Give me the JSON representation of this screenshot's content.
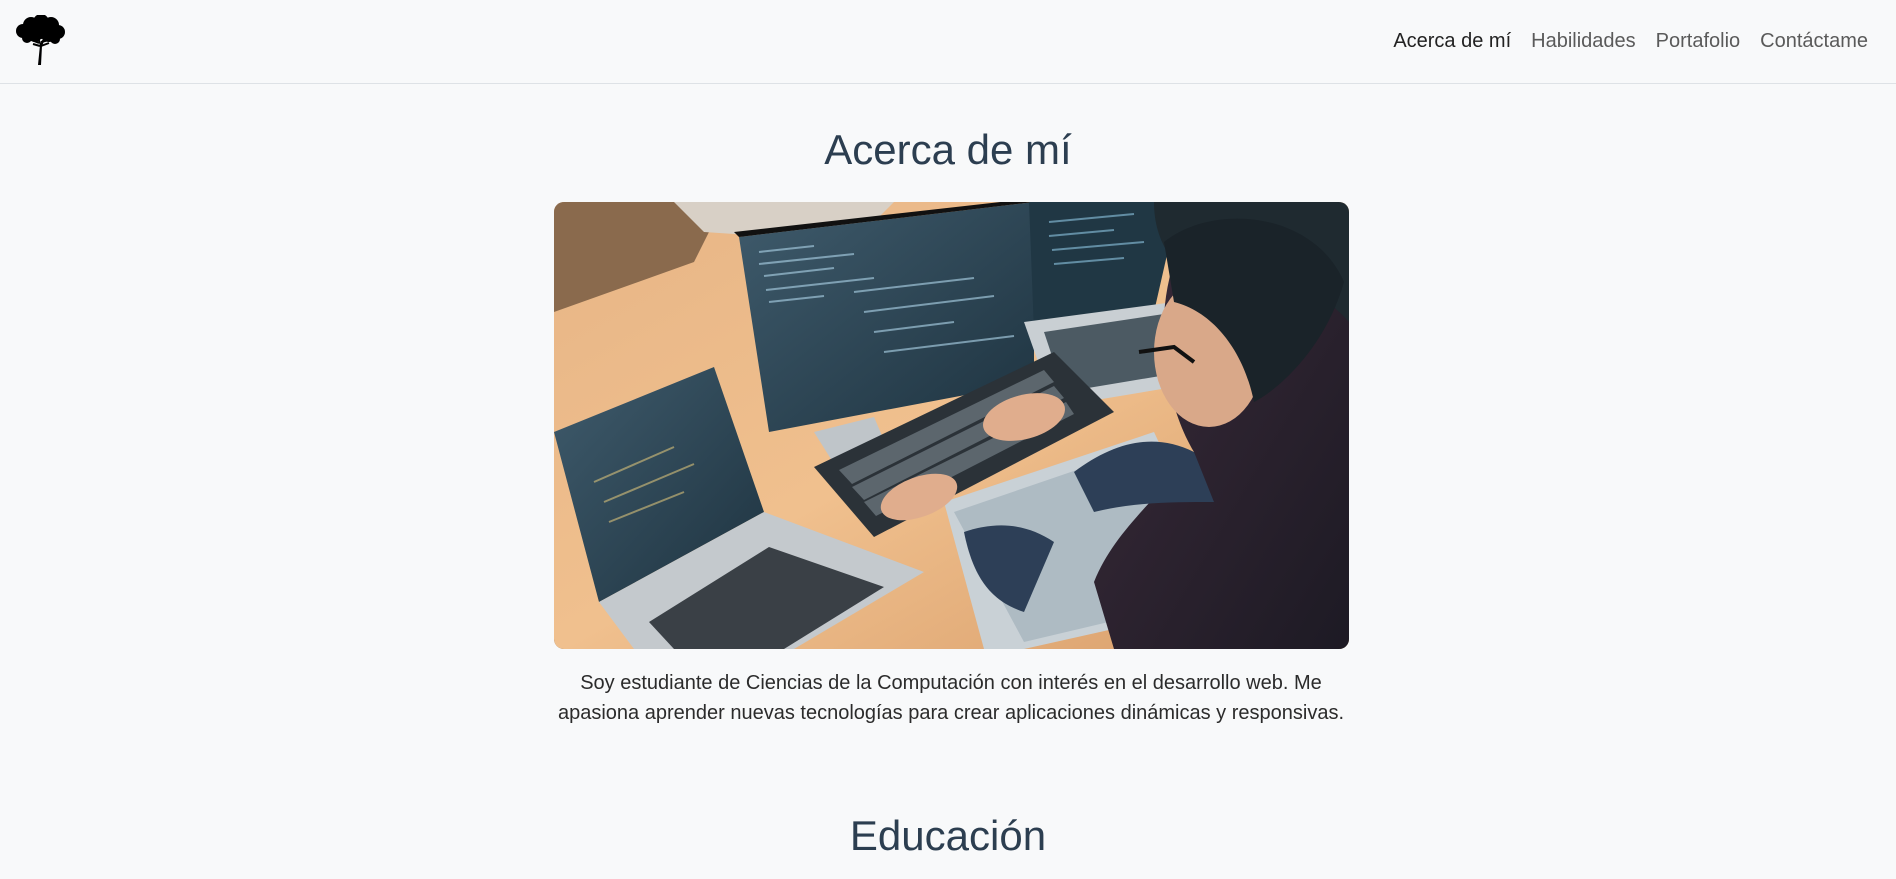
{
  "nav": {
    "brand_icon": "tree-logo-icon",
    "items": [
      {
        "label": "Acerca de mí",
        "active": true
      },
      {
        "label": "Habilidades",
        "active": false
      },
      {
        "label": "Portafolio",
        "active": false
      },
      {
        "label": "Contáctame",
        "active": false
      }
    ]
  },
  "about": {
    "title": "Acerca de mí",
    "image": "developer-coding-at-desk-photo",
    "text": "Soy estudiante de Ciencias de la Computación con interés en el desarrollo web. Me apasiona aprender nuevas tecnologías para crear aplicaciones dinámicas y responsivas."
  },
  "education": {
    "title": "Educación"
  },
  "colors": {
    "background": "#f8f9fa",
    "heading": "#2c3e50",
    "nav_link": "#5a5a5a",
    "nav_active": "#222222",
    "border": "#dee2e6"
  }
}
